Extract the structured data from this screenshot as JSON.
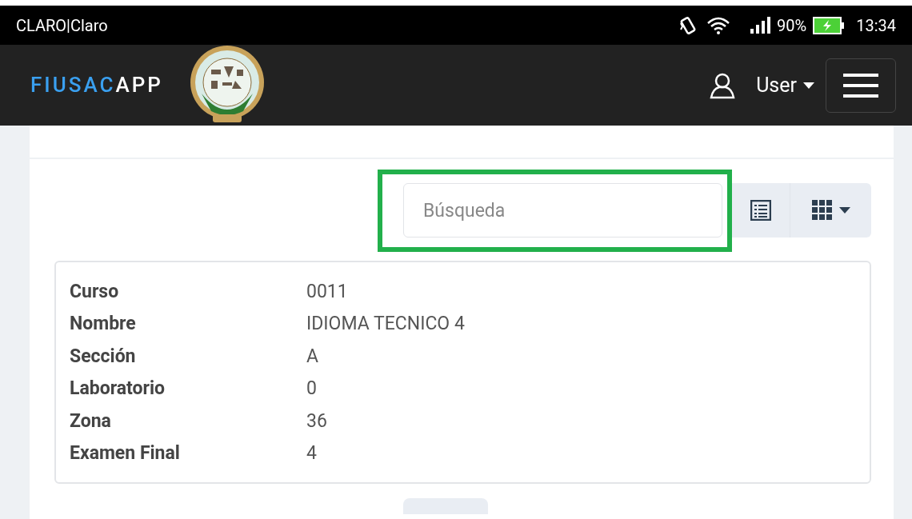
{
  "status_bar": {
    "carrier": "CLARO|Claro",
    "battery": "90%",
    "time": "13:34"
  },
  "navbar": {
    "brand_highlight": "FIUSAC",
    "brand_rest": "APP",
    "user_menu": "User"
  },
  "search": {
    "placeholder": "Búsqueda",
    "highlighted": true
  },
  "record": [
    {
      "label": "Curso",
      "value": "0011"
    },
    {
      "label": "Nombre",
      "value": "IDIOMA TECNICO 4"
    },
    {
      "label": "Sección",
      "value": "A"
    },
    {
      "label": "Laboratorio",
      "value": "0"
    },
    {
      "label": "Zona",
      "value": "36"
    },
    {
      "label": "Examen Final",
      "value": "4"
    }
  ]
}
